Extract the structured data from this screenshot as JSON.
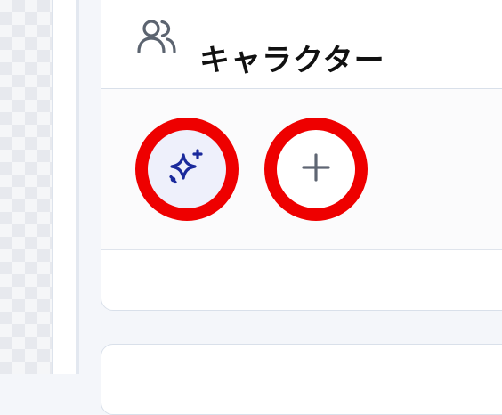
{
  "panel": {
    "title": "キャラクター",
    "header_icon": "users-icon"
  },
  "actions": [
    {
      "icon": "sparkles-icon",
      "accent": "#1b2a9c"
    },
    {
      "icon": "plus-icon",
      "accent": "#5f6673"
    }
  ],
  "colors": {
    "highlight_ring": "#ee0000",
    "border": "#d9e0ea",
    "title_text": "#111111"
  }
}
